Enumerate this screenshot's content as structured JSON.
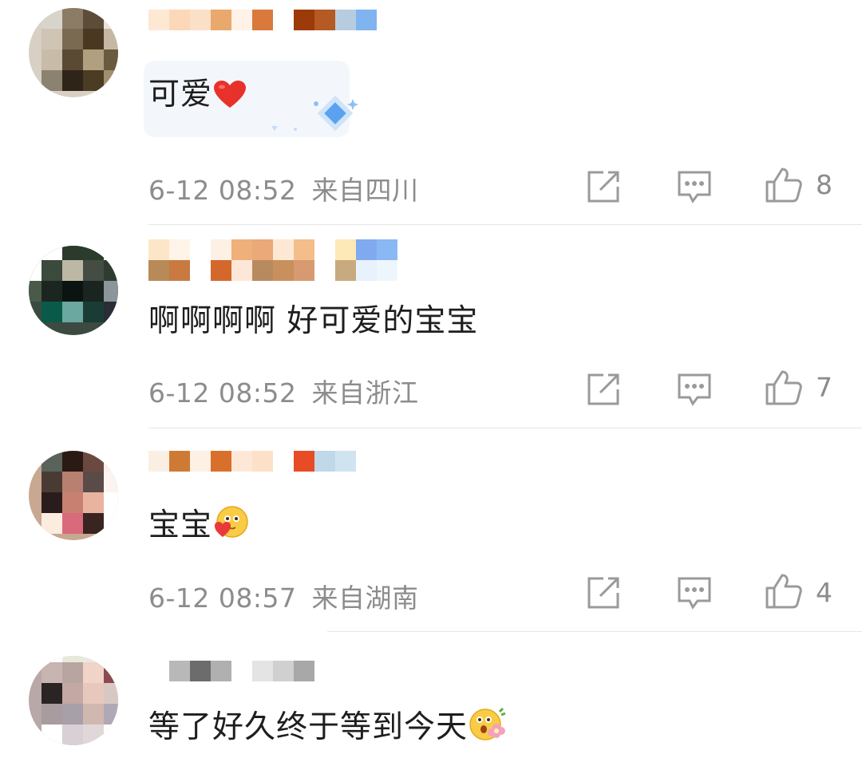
{
  "comments": [
    {
      "text": "可爱",
      "emoji": "red-heart-icon",
      "time": "6-12 08:52",
      "location": "来自四川",
      "likes": "8"
    },
    {
      "text": "啊啊啊啊 好可爱的宝宝",
      "time": "6-12 08:52",
      "location": "来自浙江",
      "likes": "7"
    },
    {
      "text": "宝宝",
      "emoji": "blushing-heart-face-icon",
      "time": "6-12 08:57",
      "location": "来自湖南",
      "likes": "4"
    },
    {
      "text": "等了好久终于等到今天",
      "emoji": "flower-face-icon"
    }
  ],
  "colors": {
    "meta_text": "#8c8c8c",
    "divider": "#e6e6e6",
    "icon_stroke": "#9a9a9a"
  }
}
